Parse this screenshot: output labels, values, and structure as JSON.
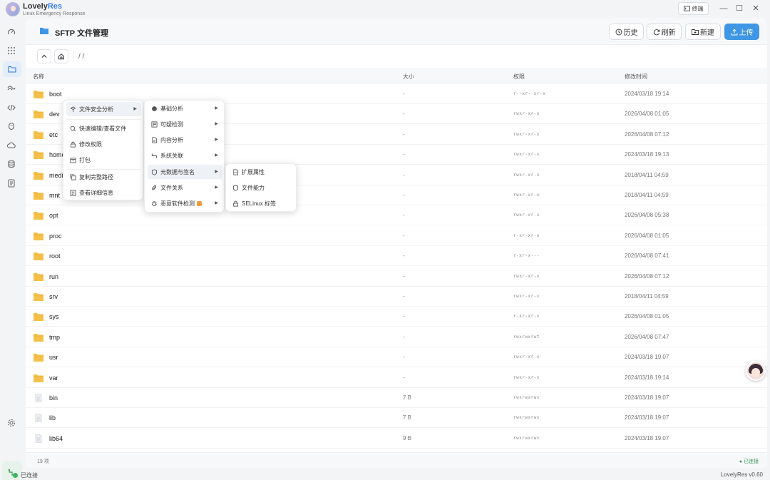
{
  "app": {
    "name_main": "Lovely",
    "name_accent": "Res",
    "subtitle": "Linux Emergency Response",
    "terminal_label": "终端"
  },
  "window": {
    "minimize": "—",
    "maximize": "☐",
    "close": "✕"
  },
  "page": {
    "title": "SFTP 文件管理"
  },
  "toolbar": {
    "history": "历史",
    "refresh": "刷新",
    "new": "新建",
    "upload": "上传"
  },
  "path": {
    "value": "/ /"
  },
  "columns": {
    "name": "名称",
    "size": "大小",
    "perm": "权限",
    "mtime": "修改时间"
  },
  "files": [
    {
      "name": "boot",
      "type": "dir",
      "size": "-",
      "perm": "r--xr--xr-x",
      "mtime": "2024/03/18 19:14"
    },
    {
      "name": "dev",
      "type": "dir",
      "size": "-",
      "perm": "rwxr-xr-x",
      "mtime": "2026/04/08 01:05"
    },
    {
      "name": "etc",
      "type": "dir",
      "size": "-",
      "perm": "rwxr-xr-x",
      "mtime": "2026/04/08 07:12"
    },
    {
      "name": "home",
      "type": "dir",
      "size": "-",
      "perm": "rwxr-xr-x",
      "mtime": "2024/03/18 19:13"
    },
    {
      "name": "media",
      "type": "dir",
      "size": "-",
      "perm": "rwxr-xr-x",
      "mtime": "2018/04/11 04:59"
    },
    {
      "name": "mnt",
      "type": "dir",
      "size": "-",
      "perm": "rwxr-xr-x",
      "mtime": "2018/04/11 04:59"
    },
    {
      "name": "opt",
      "type": "dir",
      "size": "-",
      "perm": "rwxr-xr-x",
      "mtime": "2026/04/08 05:38"
    },
    {
      "name": "proc",
      "type": "dir",
      "size": "-",
      "perm": "r-xr-xr-x",
      "mtime": "2026/04/08 01:05"
    },
    {
      "name": "root",
      "type": "dir",
      "size": "-",
      "perm": "r-xr-x---",
      "mtime": "2026/04/08 07:41"
    },
    {
      "name": "run",
      "type": "dir",
      "size": "-",
      "perm": "rwxr-xr-x",
      "mtime": "2026/04/08 07:12"
    },
    {
      "name": "srv",
      "type": "dir",
      "size": "-",
      "perm": "rwxr-xr-x",
      "mtime": "2018/04/11 04:59"
    },
    {
      "name": "sys",
      "type": "dir",
      "size": "-",
      "perm": "r-xr-xr-x",
      "mtime": "2026/04/08 01:05"
    },
    {
      "name": "tmp",
      "type": "dir",
      "size": "-",
      "perm": "rwxrwxrwt",
      "mtime": "2026/04/08 07:47"
    },
    {
      "name": "usr",
      "type": "dir",
      "size": "-",
      "perm": "rwxr-xr-x",
      "mtime": "2024/03/18 19:07"
    },
    {
      "name": "var",
      "type": "dir",
      "size": "-",
      "perm": "rwxr-xr-x",
      "mtime": "2024/03/18 19:14"
    },
    {
      "name": "bin",
      "type": "file",
      "size": "7 B",
      "perm": "rwxrwxrwx",
      "mtime": "2024/03/18 19:07"
    },
    {
      "name": "lib",
      "type": "file",
      "size": "7 B",
      "perm": "rwxrwxrwx",
      "mtime": "2024/03/18 19:07"
    },
    {
      "name": "lib64",
      "type": "file",
      "size": "9 B",
      "perm": "rwxrwxrwx",
      "mtime": "2024/03/18 19:07"
    }
  ],
  "footer": {
    "count": "19 项",
    "connection": "● 已连接"
  },
  "status": {
    "connection": "已连接",
    "version": "LovelyRes v0.60"
  },
  "context_menu": {
    "security_analysis": "文件安全分析",
    "quick_edit": "快速编辑/查看文件",
    "chmod": "修改权限",
    "pack": "打包",
    "copy_path": "复制完整路径",
    "details": "查看详细信息"
  },
  "security_submenu": {
    "basic": "基础分析",
    "suspicious": "可疑检测",
    "content": "内容分析",
    "system": "系统关联",
    "metadata": "元数据与签名",
    "relations": "文件关系",
    "malware": "恶意软件检测"
  },
  "metadata_submenu": {
    "xattr": "扩展属性",
    "caps": "文件能力",
    "selinux": "SELinux 标签"
  },
  "colors": {
    "accent": "#3f96e4",
    "folder": "#f5c04a",
    "connected": "#3bb35e"
  }
}
